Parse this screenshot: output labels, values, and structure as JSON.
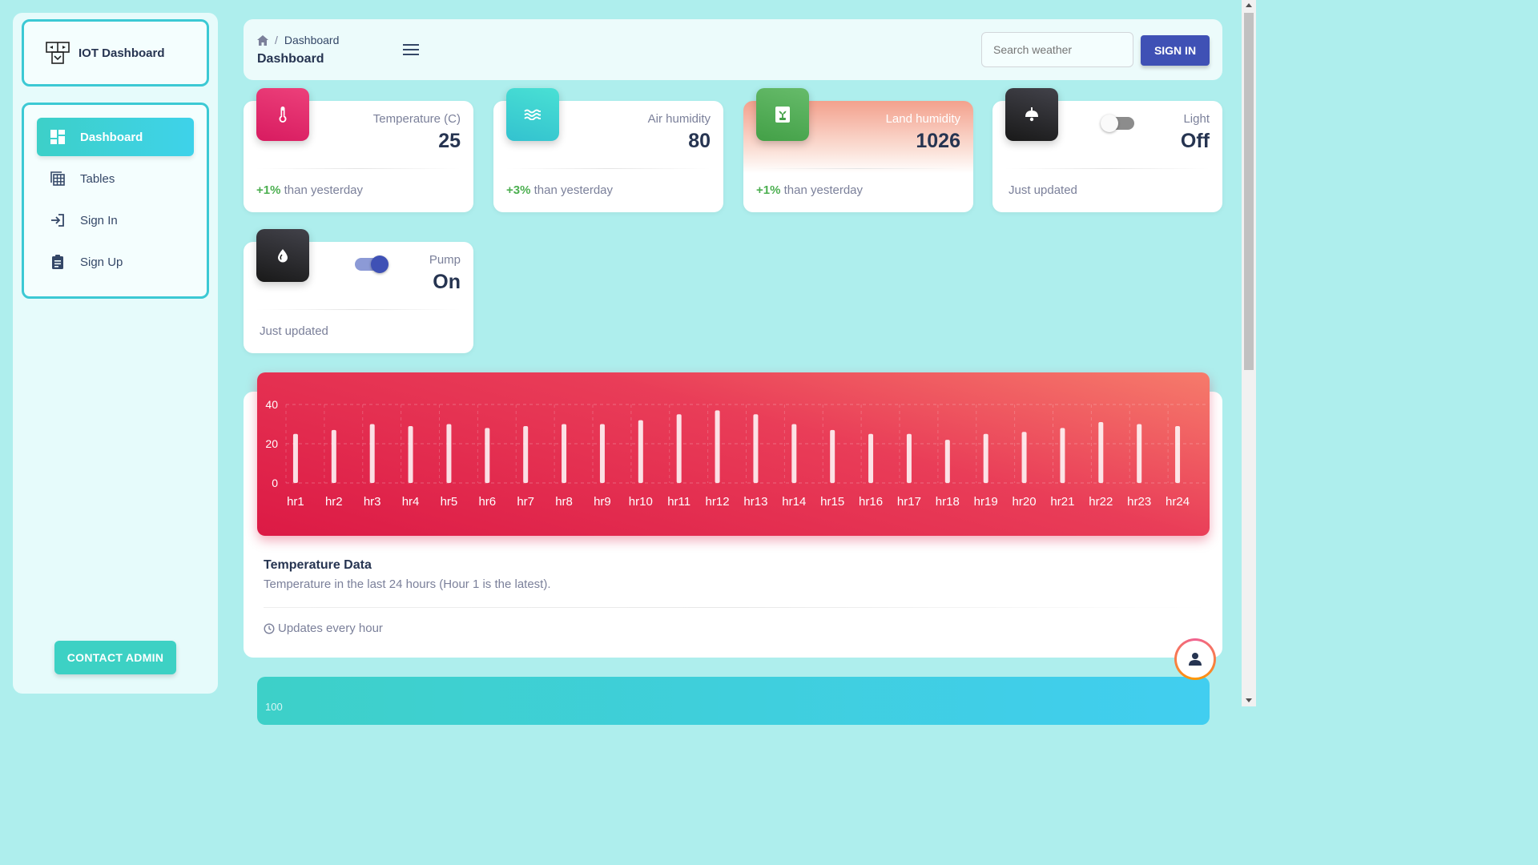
{
  "sidebar": {
    "brand": "IOT Dashboard",
    "items": [
      {
        "label": "Dashboard",
        "icon": "dashboard-icon"
      },
      {
        "label": "Tables",
        "icon": "table-icon"
      },
      {
        "label": "Sign In",
        "icon": "login-icon"
      },
      {
        "label": "Sign Up",
        "icon": "clipboard-icon"
      }
    ],
    "contact_label": "CONTACT ADMIN"
  },
  "header": {
    "breadcrumb": "Dashboard",
    "title": "Dashboard",
    "search_placeholder": "Search weather",
    "signin_label": "SIGN IN"
  },
  "cards": {
    "temperature": {
      "label": "Temperature (C)",
      "value": "25",
      "delta": "+1%",
      "foot": " than yesterday",
      "color": "#e91e63"
    },
    "air": {
      "label": "Air humidity",
      "value": "80",
      "delta": "+3%",
      "foot": " than yesterday",
      "color": "#3ed2c9"
    },
    "land": {
      "label": "Land humidity",
      "value": "1026",
      "delta": "+1%",
      "foot": " than yesterday",
      "color": "#4caf50"
    },
    "light": {
      "label": "Light",
      "value": "Off",
      "foot": "Just updated",
      "toggle_on": false
    },
    "pump": {
      "label": "Pump",
      "value": "On",
      "foot": "Just updated",
      "toggle_on": true
    }
  },
  "chart": {
    "title": "Temperature Data",
    "subtitle": "Temperature in the last 24 hours (Hour 1 is the latest).",
    "footer": "Updates every hour"
  },
  "chart_data": {
    "type": "bar",
    "categories": [
      "hr1",
      "hr2",
      "hr3",
      "hr4",
      "hr5",
      "hr6",
      "hr7",
      "hr8",
      "hr9",
      "hr10",
      "hr11",
      "hr12",
      "hr13",
      "hr14",
      "hr15",
      "hr16",
      "hr17",
      "hr18",
      "hr19",
      "hr20",
      "hr21",
      "hr22",
      "hr23",
      "hr24"
    ],
    "values": [
      25,
      27,
      30,
      29,
      30,
      28,
      29,
      30,
      30,
      32,
      35,
      37,
      35,
      30,
      27,
      25,
      25,
      22,
      25,
      26,
      28,
      31,
      30,
      29
    ],
    "ylim": [
      0,
      40
    ],
    "yticks": [
      "0",
      "20",
      "40"
    ],
    "grid": true,
    "background": "#e93d58"
  },
  "next_chart": {
    "tick": "100"
  }
}
